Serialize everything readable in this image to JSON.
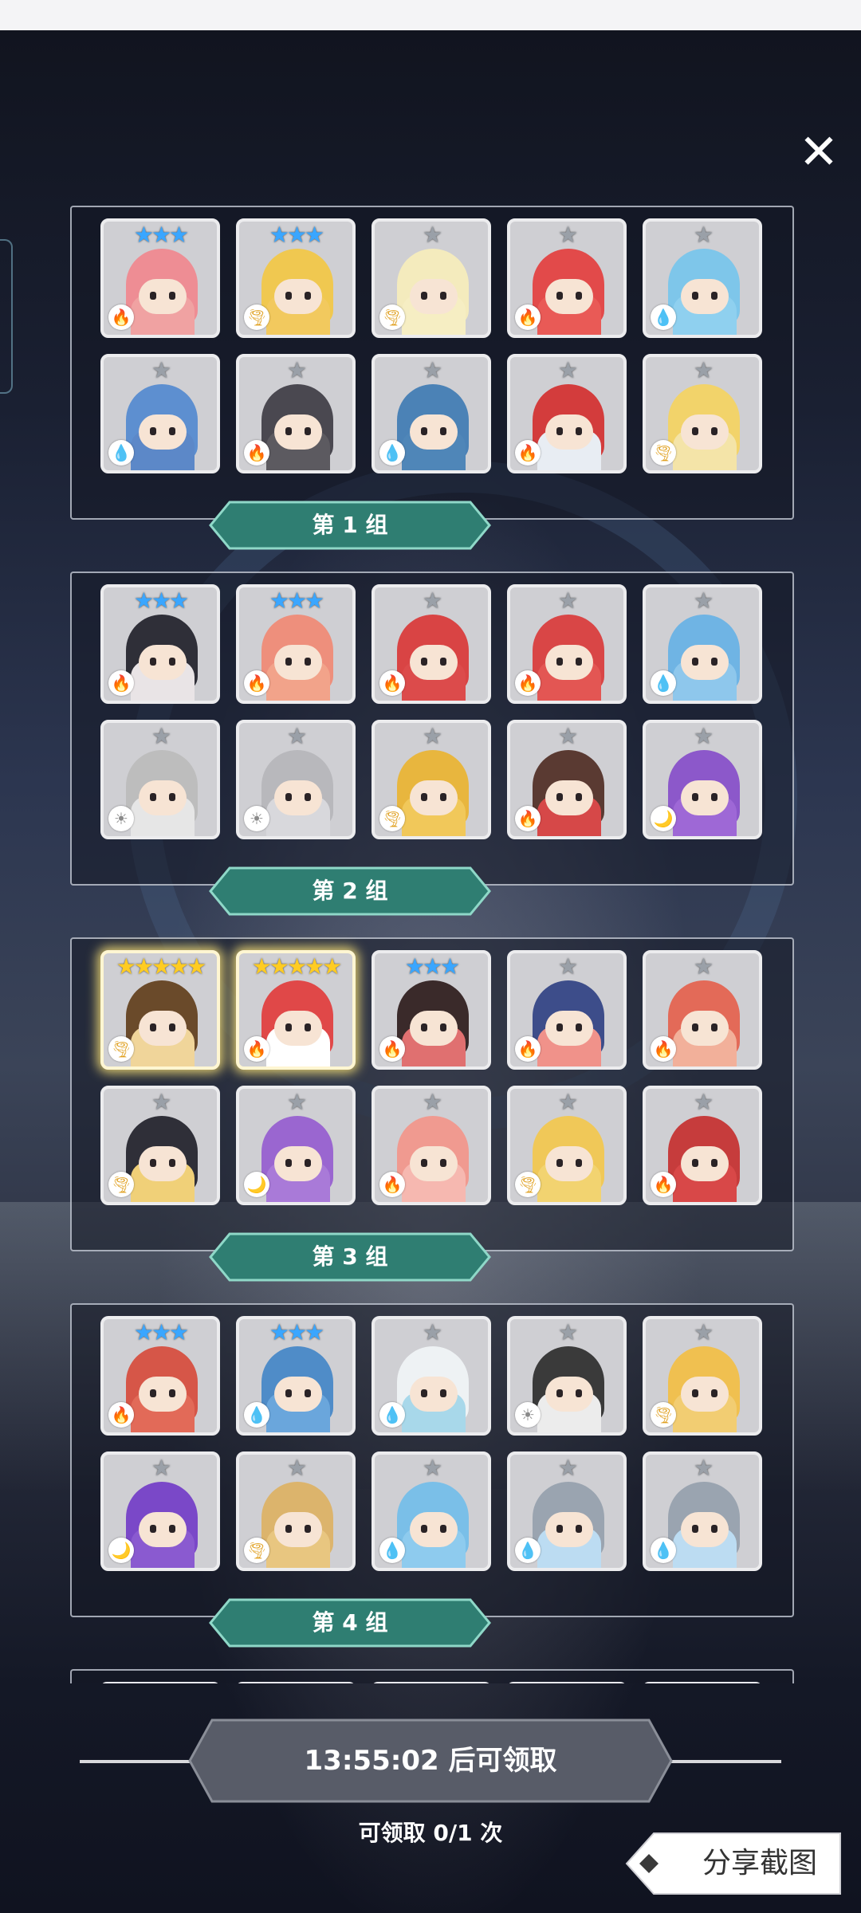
{
  "close": {
    "icon": "close-icon",
    "glyph": "✕"
  },
  "groups": [
    {
      "label": "第 1 组",
      "heroes": [
        {
          "stars": "★★★",
          "star_color": "#3aa6ff",
          "element": "fire",
          "color": "#f0a2a2",
          "hair": "#ee8d94"
        },
        {
          "stars": "★★★",
          "star_color": "#3aa6ff",
          "element": "wind",
          "color": "#f2c95e",
          "hair": "#f0c850"
        },
        {
          "stars": "★",
          "star_color": "#9aa0a8",
          "element": "wind",
          "color": "#f6eec3",
          "hair": "#f4ebbd"
        },
        {
          "stars": "★",
          "star_color": "#9aa0a8",
          "element": "fire",
          "color": "#e95a56",
          "hair": "#e24a4a"
        },
        {
          "stars": "★",
          "star_color": "#9aa0a8",
          "element": "water",
          "color": "#8fd0ef",
          "hair": "#7ec6ea"
        },
        {
          "stars": "★",
          "star_color": "#9aa0a8",
          "element": "water",
          "color": "#5c88c8",
          "hair": "#5d8fd0"
        },
        {
          "stars": "★",
          "star_color": "#9aa0a8",
          "element": "fire",
          "color": "#5c5a60",
          "hair": "#4a4850"
        },
        {
          "stars": "★",
          "star_color": "#9aa0a8",
          "element": "water",
          "color": "#4f86b8",
          "hair": "#4b82b6"
        },
        {
          "stars": "★",
          "star_color": "#9aa0a8",
          "element": "fire",
          "color": "#e8edf3",
          "hair": "#d33c3c"
        },
        {
          "stars": "★",
          "star_color": "#9aa0a8",
          "element": "wind",
          "color": "#f4e4a8",
          "hair": "#f2d36a"
        }
      ]
    },
    {
      "label": "第 2 组",
      "heroes": [
        {
          "stars": "★★★",
          "star_color": "#3aa6ff",
          "element": "fire",
          "color": "#e9e4e6",
          "hair": "#2f2f38"
        },
        {
          "stars": "★★★",
          "star_color": "#3aa6ff",
          "element": "fire",
          "color": "#f2a38a",
          "hair": "#ee8f7c"
        },
        {
          "stars": "★",
          "star_color": "#9aa0a8",
          "element": "fire",
          "color": "#dc4b4b",
          "hair": "#d94444"
        },
        {
          "stars": "★",
          "star_color": "#9aa0a8",
          "element": "fire",
          "color": "#e35653",
          "hair": "#d94646"
        },
        {
          "stars": "★",
          "star_color": "#9aa0a8",
          "element": "water",
          "color": "#8ec7ec",
          "hair": "#6fb4e4"
        },
        {
          "stars": "★",
          "star_color": "#9aa0a8",
          "element": "light",
          "color": "#e6e6e6",
          "hair": "#bdbdbd"
        },
        {
          "stars": "★",
          "star_color": "#9aa0a8",
          "element": "light",
          "color": "#d8d8dc",
          "hair": "#b8b8bc"
        },
        {
          "stars": "★",
          "star_color": "#9aa0a8",
          "element": "wind",
          "color": "#f1c85a",
          "hair": "#e8b63e"
        },
        {
          "stars": "★",
          "star_color": "#9aa0a8",
          "element": "fire",
          "color": "#d64848",
          "hair": "#5a3a32"
        },
        {
          "stars": "★",
          "star_color": "#9aa0a8",
          "element": "dark",
          "color": "#9e68d6",
          "hair": "#8c58ca"
        }
      ]
    },
    {
      "label": "第 3 组",
      "heroes": [
        {
          "stars": "★★★★★",
          "star_color": "#ffcc22",
          "element": "wind",
          "color": "#f0d59a",
          "hair": "#6a4a2a",
          "gold": true
        },
        {
          "stars": "★★★★★",
          "star_color": "#ffcc22",
          "element": "fire",
          "color": "#ffffff",
          "hair": "#e04848",
          "gold": true
        },
        {
          "stars": "★★★",
          "star_color": "#3aa6ff",
          "element": "fire",
          "color": "#e07070",
          "hair": "#3a2a2a"
        },
        {
          "stars": "★",
          "star_color": "#9aa0a8",
          "element": "fire",
          "color": "#f0928a",
          "hair": "#3d4d8a"
        },
        {
          "stars": "★",
          "star_color": "#9aa0a8",
          "element": "fire",
          "color": "#f2b09a",
          "hair": "#e36a58"
        },
        {
          "stars": "★",
          "star_color": "#9aa0a8",
          "element": "wind",
          "color": "#f0d078",
          "hair": "#2f2f38"
        },
        {
          "stars": "★",
          "star_color": "#9aa0a8",
          "element": "dark",
          "color": "#a97ad8",
          "hair": "#9a66d0"
        },
        {
          "stars": "★",
          "star_color": "#9aa0a8",
          "element": "fire",
          "color": "#f6b8b0",
          "hair": "#f09a90"
        },
        {
          "stars": "★",
          "star_color": "#9aa0a8",
          "element": "wind",
          "color": "#f2d370",
          "hair": "#f0c858"
        },
        {
          "stars": "★",
          "star_color": "#9aa0a8",
          "element": "fire",
          "color": "#d84848",
          "hair": "#c63c3c"
        }
      ]
    },
    {
      "label": "第 4 组",
      "heroes": [
        {
          "stars": "★★★",
          "star_color": "#3aa6ff",
          "element": "fire",
          "color": "#e26a58",
          "hair": "#d65648"
        },
        {
          "stars": "★★★",
          "star_color": "#3aa6ff",
          "element": "water",
          "color": "#6aa6dc",
          "hair": "#4f8cc8"
        },
        {
          "stars": "★",
          "star_color": "#9aa0a8",
          "element": "water",
          "color": "#a8d8ea",
          "hair": "#eef2f4"
        },
        {
          "stars": "★",
          "star_color": "#9aa0a8",
          "element": "light",
          "color": "#ececec",
          "hair": "#3a3a3a"
        },
        {
          "stars": "★",
          "star_color": "#9aa0a8",
          "element": "wind",
          "color": "#f2cd72",
          "hair": "#f0c050"
        },
        {
          "stars": "★",
          "star_color": "#9aa0a8",
          "element": "dark",
          "color": "#8a5ad0",
          "hair": "#7a48c8"
        },
        {
          "stars": "★",
          "star_color": "#9aa0a8",
          "element": "wind",
          "color": "#e8c680",
          "hair": "#dcb46c"
        },
        {
          "stars": "★",
          "star_color": "#9aa0a8",
          "element": "water",
          "color": "#8ecbee",
          "hair": "#7abfe8"
        },
        {
          "stars": "★",
          "star_color": "#9aa0a8",
          "element": "water",
          "color": "#bcdcf2",
          "hair": "#9aa4b0"
        },
        {
          "stars": "★",
          "star_color": "#9aa0a8",
          "element": "water",
          "color": "#bcdcf2",
          "hair": "#9aa4b0"
        }
      ]
    }
  ],
  "element_glyphs": {
    "fire": "🔥",
    "water": "💧",
    "wind": "🌪",
    "light": "☀",
    "dark": "🌙"
  },
  "element_colors": {
    "fire": "#e24a2a",
    "water": "#2c8ee0",
    "wind": "#e0a020",
    "light": "#8a8a8a",
    "dark": "#b040d0"
  },
  "timer": {
    "label": "13:55:02 后可领取"
  },
  "claim": {
    "text": "可领取 0/1 次"
  },
  "share": {
    "label": "分享截图"
  },
  "colors": {
    "banner": "#2f7e72",
    "banner_edge": "#8fd8c8",
    "timer_bg": "#585c68"
  }
}
